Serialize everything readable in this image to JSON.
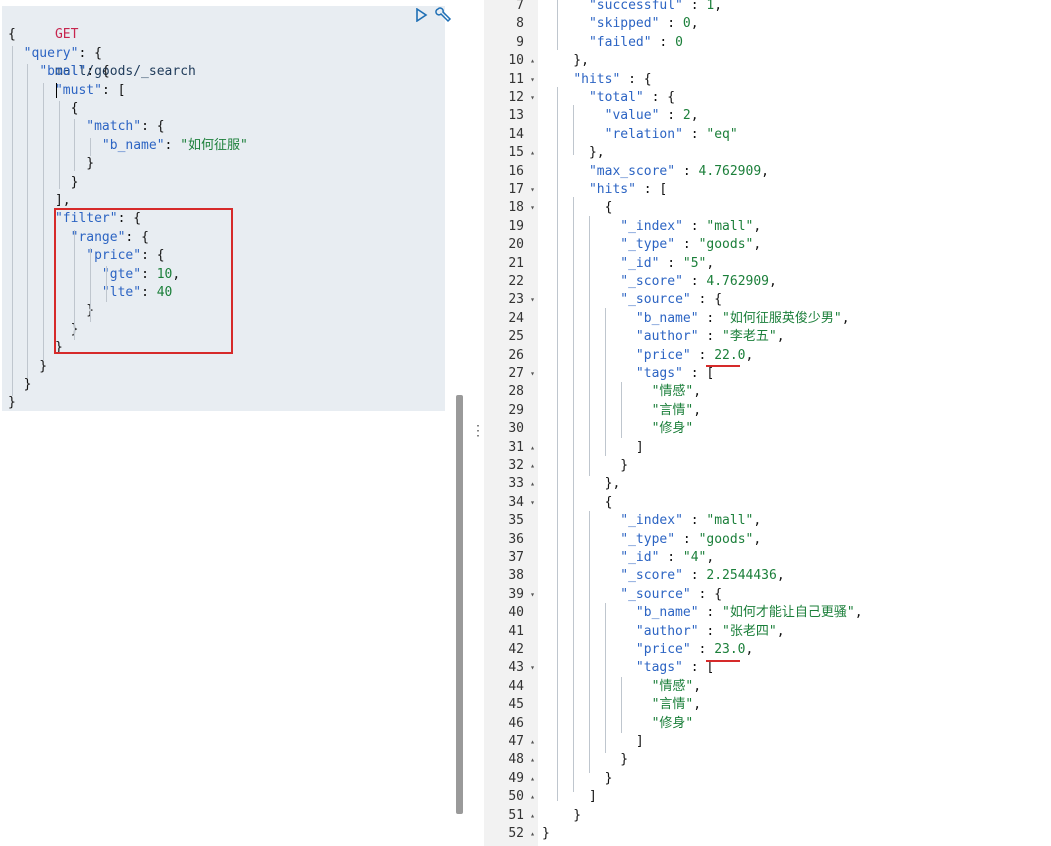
{
  "request": {
    "method": "GET",
    "path": "mall/goods/_search",
    "body_lines": [
      [
        "{"
      ],
      [
        "  ",
        "\"query\"",
        ": {"
      ],
      [
        "    ",
        "\"bool\"",
        ": {"
      ],
      [
        "      ",
        "\"must\"",
        ": ["
      ],
      [
        "        {"
      ],
      [
        "          ",
        "\"match\"",
        ": {"
      ],
      [
        "            ",
        "\"b_name\"",
        ": ",
        "\"如何征服\""
      ],
      [
        "          }"
      ],
      [
        "        }"
      ],
      [
        "      ],"
      ],
      [
        "      ",
        "\"filter\"",
        ": {"
      ],
      [
        "        ",
        "\"range\"",
        ": {"
      ],
      [
        "          ",
        "\"price\"",
        ": {"
      ],
      [
        "            ",
        "\"gte\"",
        ": ",
        "10",
        ","
      ],
      [
        "            ",
        "\"lte\"",
        ": ",
        "40"
      ],
      [
        "          }"
      ],
      [
        "        }"
      ],
      [
        "      }"
      ],
      [
        "    }"
      ],
      [
        "  }"
      ],
      [
        "}"
      ]
    ]
  },
  "icons": {
    "run": "play-icon",
    "settings": "wrench-icon",
    "divider": "vertical-ellipsis-icon"
  },
  "colors": {
    "method": "#c7254e",
    "key": "#2c64c3",
    "string": "#1b7f3a",
    "highlight": "#d62a2a"
  },
  "response": {
    "lines": [
      {
        "n": "7",
        "fold": "",
        "text": [
          "      ",
          "\"successful\"",
          " : ",
          "1",
          ","
        ]
      },
      {
        "n": "8",
        "fold": "",
        "text": [
          "      ",
          "\"skipped\"",
          " : ",
          "0",
          ","
        ]
      },
      {
        "n": "9",
        "fold": "",
        "text": [
          "      ",
          "\"failed\"",
          " : ",
          "0"
        ]
      },
      {
        "n": "10",
        "fold": "▴",
        "text": [
          "    },"
        ]
      },
      {
        "n": "11",
        "fold": "▾",
        "text": [
          "    ",
          "\"hits\"",
          " : {"
        ]
      },
      {
        "n": "12",
        "fold": "▾",
        "text": [
          "      ",
          "\"total\"",
          " : {"
        ]
      },
      {
        "n": "13",
        "fold": "",
        "text": [
          "        ",
          "\"value\"",
          " : ",
          "2",
          ","
        ]
      },
      {
        "n": "14",
        "fold": "",
        "text": [
          "        ",
          "\"relation\"",
          " : ",
          "\"eq\""
        ]
      },
      {
        "n": "15",
        "fold": "▴",
        "text": [
          "      },"
        ]
      },
      {
        "n": "16",
        "fold": "",
        "text": [
          "      ",
          "\"max_score\"",
          " : ",
          "4.762909",
          ","
        ]
      },
      {
        "n": "17",
        "fold": "▾",
        "text": [
          "      ",
          "\"hits\"",
          " : ["
        ]
      },
      {
        "n": "18",
        "fold": "▾",
        "text": [
          "        {"
        ]
      },
      {
        "n": "19",
        "fold": "",
        "text": [
          "          ",
          "\"_index\"",
          " : ",
          "\"mall\"",
          ","
        ]
      },
      {
        "n": "20",
        "fold": "",
        "text": [
          "          ",
          "\"_type\"",
          " : ",
          "\"goods\"",
          ","
        ]
      },
      {
        "n": "21",
        "fold": "",
        "text": [
          "          ",
          "\"_id\"",
          " : ",
          "\"5\"",
          ","
        ]
      },
      {
        "n": "22",
        "fold": "",
        "text": [
          "          ",
          "\"_score\"",
          " : ",
          "4.762909",
          ","
        ]
      },
      {
        "n": "23",
        "fold": "▾",
        "text": [
          "          ",
          "\"_source\"",
          " : {"
        ]
      },
      {
        "n": "24",
        "fold": "",
        "text": [
          "            ",
          "\"b_name\"",
          " : ",
          "\"如何征服英俊少男\"",
          ","
        ]
      },
      {
        "n": "25",
        "fold": "",
        "text": [
          "            ",
          "\"author\"",
          " : ",
          "\"李老五\"",
          ","
        ]
      },
      {
        "n": "26",
        "fold": "",
        "text": [
          "            ",
          "\"price\"",
          " : ",
          "22.0",
          ","
        ]
      },
      {
        "n": "27",
        "fold": "▾",
        "text": [
          "            ",
          "\"tags\"",
          " : ["
        ]
      },
      {
        "n": "28",
        "fold": "",
        "text": [
          "              ",
          "\"情感\"",
          ","
        ]
      },
      {
        "n": "29",
        "fold": "",
        "text": [
          "              ",
          "\"言情\"",
          ","
        ]
      },
      {
        "n": "30",
        "fold": "",
        "text": [
          "              ",
          "\"修身\""
        ]
      },
      {
        "n": "31",
        "fold": "▴",
        "text": [
          "            ]"
        ]
      },
      {
        "n": "32",
        "fold": "▴",
        "text": [
          "          }"
        ]
      },
      {
        "n": "33",
        "fold": "▴",
        "text": [
          "        },"
        ]
      },
      {
        "n": "34",
        "fold": "▾",
        "text": [
          "        {"
        ]
      },
      {
        "n": "35",
        "fold": "",
        "text": [
          "          ",
          "\"_index\"",
          " : ",
          "\"mall\"",
          ","
        ]
      },
      {
        "n": "36",
        "fold": "",
        "text": [
          "          ",
          "\"_type\"",
          " : ",
          "\"goods\"",
          ","
        ]
      },
      {
        "n": "37",
        "fold": "",
        "text": [
          "          ",
          "\"_id\"",
          " : ",
          "\"4\"",
          ","
        ]
      },
      {
        "n": "38",
        "fold": "",
        "text": [
          "          ",
          "\"_score\"",
          " : ",
          "2.2544436",
          ","
        ]
      },
      {
        "n": "39",
        "fold": "▾",
        "text": [
          "          ",
          "\"_source\"",
          " : {"
        ]
      },
      {
        "n": "40",
        "fold": "",
        "text": [
          "            ",
          "\"b_name\"",
          " : ",
          "\"如何才能让自己更骚\"",
          ","
        ]
      },
      {
        "n": "41",
        "fold": "",
        "text": [
          "            ",
          "\"author\"",
          " : ",
          "\"张老四\"",
          ","
        ]
      },
      {
        "n": "42",
        "fold": "",
        "text": [
          "            ",
          "\"price\"",
          " : ",
          "23.0",
          ","
        ]
      },
      {
        "n": "43",
        "fold": "▾",
        "text": [
          "            ",
          "\"tags\"",
          " : ["
        ]
      },
      {
        "n": "44",
        "fold": "",
        "text": [
          "              ",
          "\"情感\"",
          ","
        ]
      },
      {
        "n": "45",
        "fold": "",
        "text": [
          "              ",
          "\"言情\"",
          ","
        ]
      },
      {
        "n": "46",
        "fold": "",
        "text": [
          "              ",
          "\"修身\""
        ]
      },
      {
        "n": "47",
        "fold": "▴",
        "text": [
          "            ]"
        ]
      },
      {
        "n": "48",
        "fold": "▴",
        "text": [
          "          }"
        ]
      },
      {
        "n": "49",
        "fold": "▴",
        "text": [
          "        }"
        ]
      },
      {
        "n": "50",
        "fold": "▴",
        "text": [
          "      ]"
        ]
      },
      {
        "n": "51",
        "fold": "▴",
        "text": [
          "    }"
        ]
      },
      {
        "n": "52",
        "fold": "▴",
        "text": [
          "}"
        ]
      }
    ]
  }
}
